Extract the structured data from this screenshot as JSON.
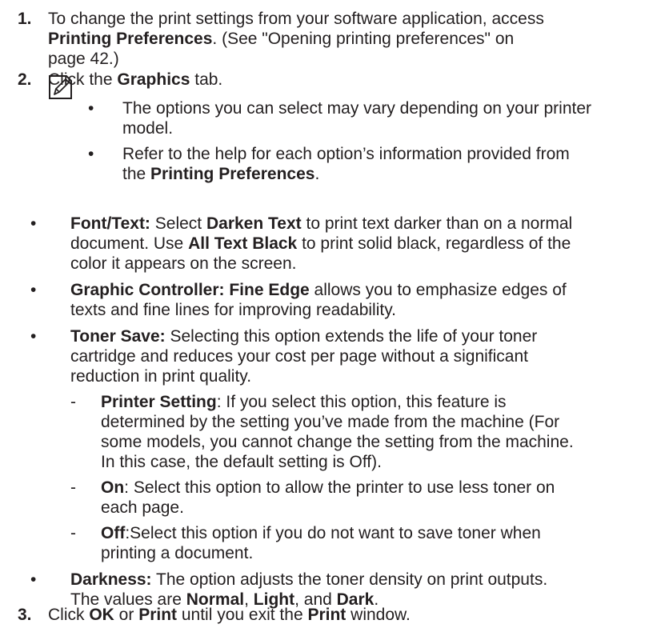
{
  "step1": {
    "number": "1.",
    "line1": "To change the print settings from your software application, access",
    "line2_bold": "Printing Preferences",
    "line2_rest": ". (See \"Opening printing preferences\" on",
    "line3": "page 42.)"
  },
  "step2": {
    "number": "2.",
    "text_before": "Click the ",
    "bold": "Graphics",
    "text_after": " tab."
  },
  "note": {
    "icon": "note-pencil-icon",
    "bullet": "•",
    "item1_line1": "The options you can select may vary depending on your printer",
    "item1_line2": "model.",
    "item2_line1": "Refer to the help for each option’s information provided from",
    "item2_line2_prefix": "the ",
    "item2_line2_bold": "Printing Preferences",
    "item2_line2_suffix": "."
  },
  "font_text": {
    "label": "Font/Text:",
    "l1_a": "  Select ",
    "l1_bold": "Darken Text",
    "l1_b": " to print text darker than on a normal",
    "l2_a": "document. Use ",
    "l2_bold": "All Text Black",
    "l2_b": " to print solid black, regardless of the",
    "l3": "color it appears on the screen."
  },
  "graphic_controller": {
    "label": "Graphic Controller:  Fine Edge",
    "l1_rest": " allows you to emphasize edges of",
    "l2": "texts and fine lines for improving readability."
  },
  "toner_save": {
    "label": "Toner Save:",
    "l1_rest": "  Selecting this option extends the life of your toner",
    "l2": "cartridge and reduces your cost per page without a significant",
    "l3": "reduction in print quality.",
    "dash": "-",
    "printer_setting": {
      "label": "Printer Setting",
      "l1_rest": ": If you select this option, this feature is",
      "l2": "determined by the setting you’ve made from the machine (For",
      "l3": "some models, you cannot change the setting from the machine.",
      "l4": "In this case, the default setting is Off)."
    },
    "on": {
      "label": "On",
      "l1_rest": ": Select this option to allow the printer to use less toner on",
      "l2": "each page."
    },
    "off": {
      "label": "Off",
      "l1_rest": ":Select this option if you do not want to save toner when",
      "l2": "printing a document."
    }
  },
  "darkness": {
    "label": "Darkness:",
    "l1_rest": "  The option adjusts the toner density on print outputs.",
    "l2_a": "The values are ",
    "normal": "Normal",
    "comma1": ", ",
    "light": "Light",
    "and": ", and ",
    "dark": "Dark",
    "period": "."
  },
  "step3": {
    "number": "3.",
    "a": "Click ",
    "ok": "OK",
    "or": " or ",
    "print": "Print",
    "b": " until you exit the ",
    "print_window": "Print",
    "c": " window."
  },
  "bullet_char": "•"
}
